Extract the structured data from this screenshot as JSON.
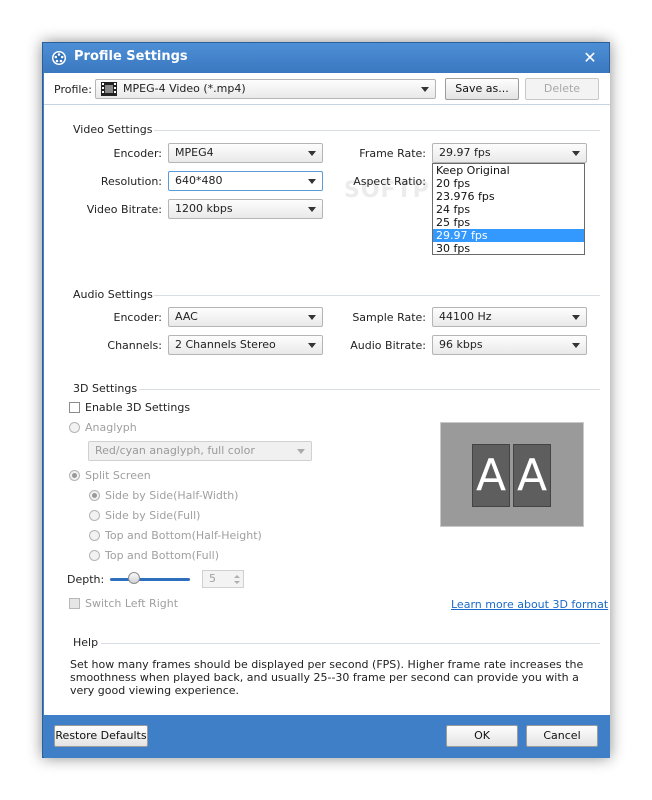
{
  "window": {
    "title": "Profile Settings",
    "close_glyph": "✕"
  },
  "profile": {
    "label": "Profile:",
    "value": "MPEG-4 Video (*.mp4)",
    "save_as": "Save as...",
    "delete": "Delete"
  },
  "video": {
    "section": "Video Settings",
    "encoder_label": "Encoder:",
    "encoder": "MPEG4",
    "resolution_label": "Resolution:",
    "resolution": "640*480",
    "bitrate_label": "Video Bitrate:",
    "bitrate": "1200 kbps",
    "framerate_label": "Frame Rate:",
    "framerate": "29.97 fps",
    "aspect_label": "Aspect Ratio:",
    "framerate_options": [
      "Keep Original",
      "20 fps",
      "23.976 fps",
      "24 fps",
      "25 fps",
      "29.97 fps",
      "30 fps"
    ]
  },
  "audio": {
    "section": "Audio Settings",
    "encoder_label": "Encoder:",
    "encoder": "AAC",
    "channels_label": "Channels:",
    "channels": "2 Channels Stereo",
    "samplerate_label": "Sample Rate:",
    "samplerate": "44100 Hz",
    "bitrate_label": "Audio Bitrate:",
    "bitrate": "96 kbps"
  },
  "three_d": {
    "section": "3D Settings",
    "enable_label": "Enable 3D Settings",
    "anaglyph_label": "Anaglyph",
    "anaglyph_value": "Red/cyan anaglyph, full color",
    "split_label": "Split Screen",
    "sbs_half": "Side by Side(Half-Width)",
    "sbs_full": "Side by Side(Full)",
    "tb_half": "Top and Bottom(Half-Height)",
    "tb_full": "Top and Bottom(Full)",
    "depth_label": "Depth:",
    "depth_value": "5",
    "switch_label": "Switch Left Right",
    "learn_more": "Learn more about 3D format",
    "preview_left": "A",
    "preview_right": "A"
  },
  "help": {
    "section": "Help",
    "text": "Set how many frames should be displayed per second (FPS). Higher frame rate increases the smoothness when played back, and usually 25--30 frame per second can provide you with a very good viewing experience."
  },
  "footer": {
    "restore": "Restore Defaults",
    "ok": "OK",
    "cancel": "Cancel"
  },
  "watermark": "SOFTPEDIA"
}
